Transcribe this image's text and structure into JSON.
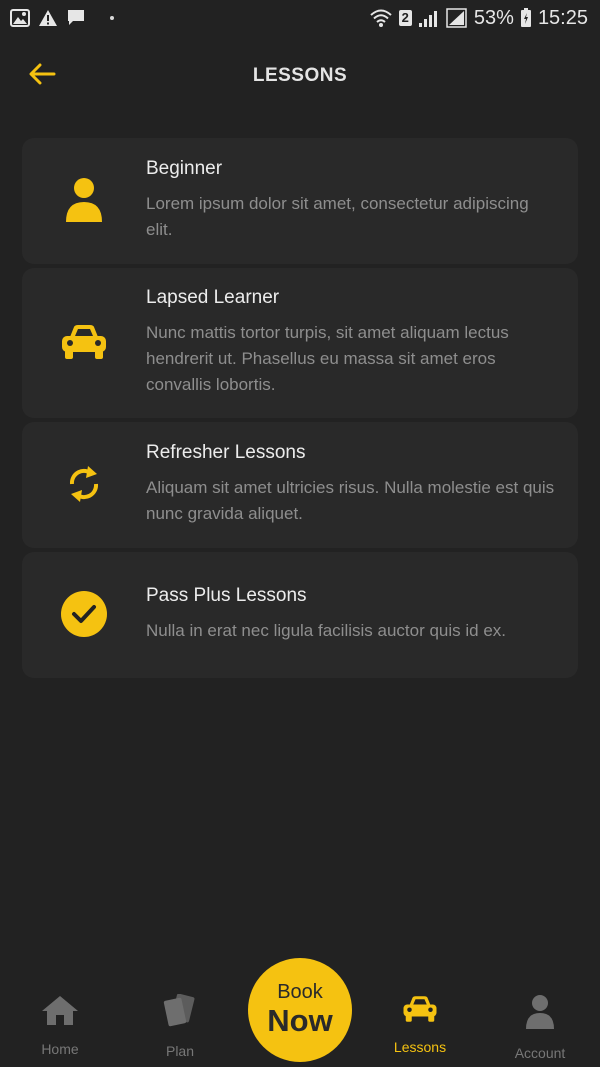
{
  "status_bar": {
    "battery": "53%",
    "time": "15:25",
    "sim_badge": "2"
  },
  "header": {
    "title": "LESSONS",
    "back_icon": "arrow-left-icon"
  },
  "lessons": [
    {
      "title": "Beginner",
      "description": "Lorem ipsum dolor sit amet, consectetur adipiscing elit.",
      "icon": "person-icon"
    },
    {
      "title": "Lapsed Learner",
      "description": "Nunc mattis tortor turpis, sit amet aliquam lectus hendrerit ut. Phasellus eu massa sit amet eros convallis lobortis.",
      "icon": "car-icon"
    },
    {
      "title": "Refresher Lessons",
      "description": "Aliquam sit amet ultricies risus. Nulla molestie est quis nunc gravida aliquet.",
      "icon": "refresh-icon"
    },
    {
      "title": "Pass Plus Lessons",
      "description": "Nulla in erat nec ligula facilisis auctor quis id ex.",
      "icon": "check-circle-icon"
    }
  ],
  "nav": {
    "home": "Home",
    "plan": "Plan",
    "lessons": "Lessons",
    "account": "Account",
    "book_line1": "Book",
    "book_line2": "Now",
    "active": "lessons"
  },
  "colors": {
    "background": "#222222",
    "card": "#292929",
    "accent": "#f5c211",
    "muted_text": "#8e8e8e",
    "inactive_nav": "#777777"
  }
}
